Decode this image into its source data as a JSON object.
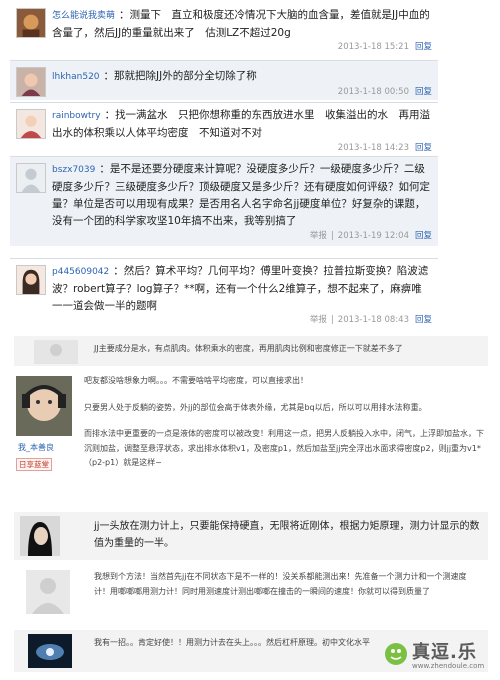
{
  "posts": [
    {
      "user": "怎么能说我卖萌",
      "text": "测量下　直立和极度还冷情况下大脑的血含量，差值就是JJ中血的含量了，然后JJ的重量就出来了　估测LZ不超过20g",
      "time": "2013-1-18 15:21",
      "reply": "回复"
    },
    {
      "user": "lhkhan520",
      "text": "那就把除JJ外的部分全切除了称",
      "time": "2013-1-18 00:50",
      "reply": "回复"
    },
    {
      "user": "rainbowtry",
      "text": "找一满盆水　只把你想称重的东西放进水里　收集溢出的水　再用溢出水的体积乘以人体平均密度　不知道对不对",
      "time": "2013-1-18 14:23",
      "reply": "回复"
    },
    {
      "user": "bszx7039",
      "text": "是不是还要分硬度来计算呢？没硬度多少斤？一级硬度多少斤？二级硬度多少斤？三级硬度多少斤？顶级硬度又是多少斤？还有硬度如何评级？如何定量？单位是否可以用现有成果？是否用名人名字命名jj硬度单位？好复杂的课题，没有一个团的科学家攻坚10年搞不出来，我等别搞了",
      "report": "举报",
      "time": "2013-1-19 12:04",
      "reply": "回复"
    },
    {
      "user": "p445609042",
      "text": "然后？算术平均？几何平均？傅里叶变换？拉普拉斯变换？陷波滤波？robert算子？log算子？**啊，还有一个什么2维算子，想不起来了，麻痹唯一一道会做一半的题啊",
      "report": "举报",
      "time": "2013-1-18 08:43",
      "reply": "回复"
    }
  ],
  "long_posts": [
    {
      "text": "JJ主要成分是水，有点肌肉。体积乘水的密度，再用肌肉比例和密度修正一下就差不多了"
    },
    {
      "user": "我_本善良",
      "badge": "日享蓝堂",
      "paragraphs": [
        "吧友都没啥想象力啊。。。不需要啥啥平均密度，可以直接求出！",
        "只要男人处于反躺的姿势，外jj的部位会高于体表外缘，尤其是bq以后，所以可以用排水法称重。",
        "而排水法中更重要的一点是液体的密度可以被改变！利用这一点，把男人反躺投入水中，闭气，上浮即加盐水，下沉则加盐，调整至悬浮状态，求出排水体积v1，及密度p1，然后加盐至jj完全浮出水面求得密度p2，则jj重为v1*（p2-p1）就是这样~"
      ]
    },
    {
      "text": "jj一头放在测力计上，只要能保持硬直，无限将近刚体，根据力矩原理，测力计显示的数值为重量的一半。"
    },
    {
      "paragraphs": [
        "我想到个方法！当然首先jj在不同状态下是不一样的！没关系都能测出来！先准备一个测力计和一个测速度计！用啷啷啷用测力计！同时用测速度计测出啷啷在撞击的一瞬间的速度！你就可以得到质量了"
      ]
    },
    {
      "text": "我有一招。。肯定好使！！用测力计去在头上。。。然后杠杆原理。初中文化水平"
    }
  ],
  "watermark": {
    "brand": "真逗.乐",
    "url": "www.zhendoule.com"
  }
}
